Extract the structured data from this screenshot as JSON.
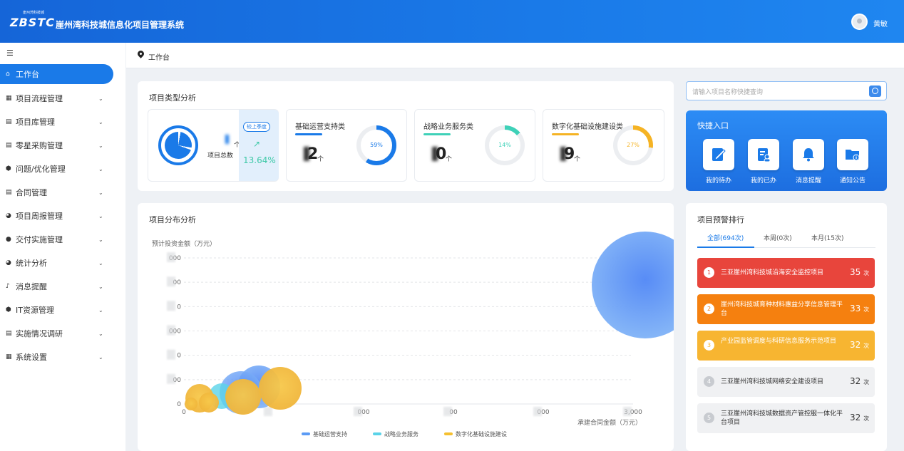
{
  "header": {
    "logo_text": "ZBSTC",
    "logo_sub": "崖州湾科技城",
    "title": "崖州湾科技城信息化项目管理系统",
    "username": "黄敏"
  },
  "sidebar": {
    "items": [
      {
        "label": "工作台",
        "icon": "home-icon"
      },
      {
        "label": "项目流程管理",
        "icon": "grid-icon"
      },
      {
        "label": "项目库管理",
        "icon": "database-icon"
      },
      {
        "label": "零星采购管理",
        "icon": "cart-icon"
      },
      {
        "label": "问题/优化管理",
        "icon": "shield-icon"
      },
      {
        "label": "合同管理",
        "icon": "document-icon"
      },
      {
        "label": "项目周报管理",
        "icon": "pie-icon"
      },
      {
        "label": "交付实施管理",
        "icon": "user-icon"
      },
      {
        "label": "统计分析",
        "icon": "pie-icon"
      },
      {
        "label": "消息提醒",
        "icon": "bell-icon"
      },
      {
        "label": "IT资源管理",
        "icon": "shield-icon"
      },
      {
        "label": "实施情况调研",
        "icon": "document-icon"
      },
      {
        "label": "系统设置",
        "icon": "grid-icon"
      }
    ]
  },
  "breadcrumb": {
    "current": "工作台"
  },
  "type_analysis": {
    "title": "项目类型分析",
    "total_label": "项目总数",
    "total_unit": "个",
    "compare_badge": "较上季度",
    "compare_value": "13.64%",
    "cards": [
      {
        "name": "基础运营支持类",
        "count_suffix": "2",
        "unit": "个",
        "percent": 59,
        "percent_label": "59%",
        "color": "#1a7ae8"
      },
      {
        "name": "战略业务服务类",
        "count_suffix": "0",
        "unit": "个",
        "percent": 14,
        "percent_label": "14%",
        "color": "#3fd1b8"
      },
      {
        "name": "数字化基础设施建设类",
        "count_suffix": "9",
        "unit": "个",
        "percent": 27,
        "percent_label": "27%",
        "color": "#f5b324"
      }
    ]
  },
  "search": {
    "placeholder": "请输入项目名称快捷查询"
  },
  "quick_entry": {
    "title": "快捷入口",
    "items": [
      {
        "label": "我的待办",
        "icon": "edit-icon"
      },
      {
        "label": "我的已办",
        "icon": "user-doc-icon"
      },
      {
        "label": "消息提醒",
        "icon": "bell-icon"
      },
      {
        "label": "通知公告",
        "icon": "folder-info-icon"
      }
    ]
  },
  "distribution": {
    "title": "项目分布分析"
  },
  "chart_data": {
    "type": "scatter",
    "ylabel": "预计投资金额（万元）",
    "xlabel": "承建合同金额（万元）",
    "x_ticks": [
      "0",
      "",
      "000",
      "00",
      "000",
      "3,000"
    ],
    "y_ticks": [
      "0",
      "00",
      "0",
      "000",
      "0",
      "00",
      "000"
    ],
    "legend_position": "bottom",
    "series": [
      {
        "name": "基础运营支持",
        "color": "#5b9bf5"
      },
      {
        "name": "战略业务服务",
        "color": "#5ad3e8"
      },
      {
        "name": "数字化基础设施建设",
        "color": "#f5c030"
      }
    ]
  },
  "ranking": {
    "title": "项目预警排行",
    "tabs": [
      "全部(694次)",
      "本周(0次)",
      "本月(15次)"
    ],
    "count_unit": "次",
    "items": [
      {
        "rank": "1",
        "name": "三亚崖州湾科技城沿海安全监控项目",
        "count": "35"
      },
      {
        "rank": "2",
        "name": "崖州湾科技城育种材料惠益分享信息管理平台",
        "count": "33"
      },
      {
        "rank": "3",
        "name": "产业园监管调度与科研信息服务示范项目",
        "count": "32"
      },
      {
        "rank": "4",
        "name": "三亚崖州湾科技城网络安全建设项目",
        "count": "32"
      },
      {
        "rank": "5",
        "name": "三亚崖州湾科技城数据资产管控服一体化平台项目",
        "count": "32"
      }
    ]
  }
}
